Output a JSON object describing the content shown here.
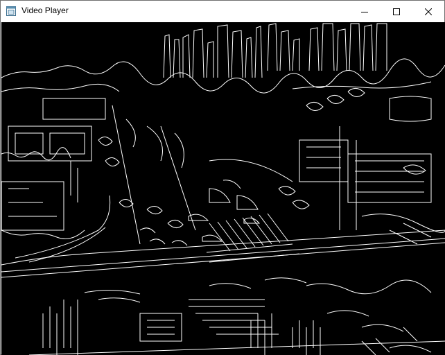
{
  "window": {
    "title": "Video Player"
  },
  "icons": {
    "app": "app-window-icon",
    "minimize": "minimize-icon",
    "maximize": "maximize-icon",
    "close": "close-icon"
  },
  "colors": {
    "frame_background": "#000000",
    "edge_color": "#ffffff",
    "titlebar": "#ffffff",
    "title_text": "#000000"
  },
  "video": {
    "description_kind": "edge-detected video frame"
  }
}
